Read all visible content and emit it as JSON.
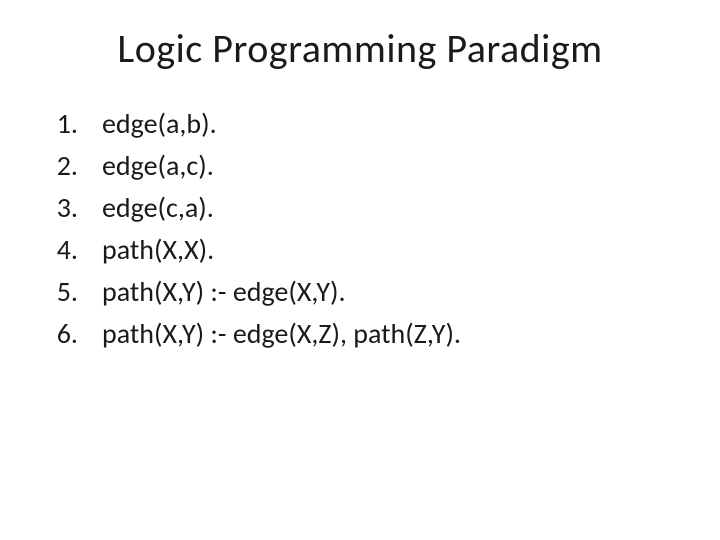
{
  "slide": {
    "title": "Logic Programming Paradigm",
    "items": [
      {
        "num": "1.",
        "text": "edge(a,b)."
      },
      {
        "num": "2.",
        "text": "edge(a,c)."
      },
      {
        "num": "3.",
        "text": "edge(c,a)."
      },
      {
        "num": "4.",
        "text": "path(X,X)."
      },
      {
        "num": "5.",
        "text": "path(X,Y) :- edge(X,Y)."
      },
      {
        "num": "6.",
        "text": "path(X,Y) :- edge(X,Z),  path(Z,Y)."
      }
    ]
  }
}
